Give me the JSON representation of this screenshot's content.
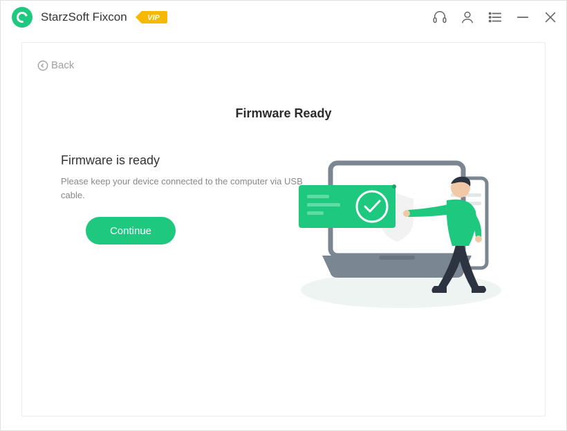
{
  "titlebar": {
    "app_name": "StarzSoft Fixcon",
    "vip_label": "VIP"
  },
  "nav": {
    "back_label": "Back"
  },
  "page": {
    "title": "Firmware Ready"
  },
  "status": {
    "heading": "Firmware is ready",
    "description": "Please keep your device connected to the computer via USB cable."
  },
  "actions": {
    "continue_label": "Continue"
  },
  "colors": {
    "accent": "#1fc87f",
    "vip_badge": "#f6b800"
  }
}
